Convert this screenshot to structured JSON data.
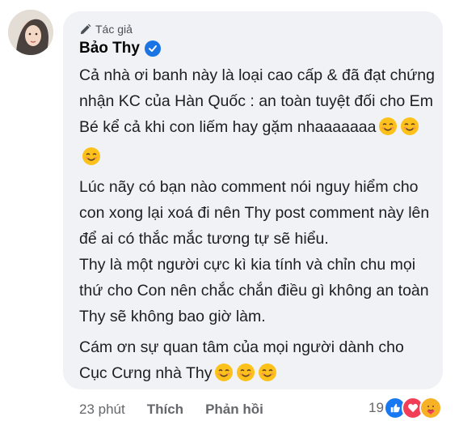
{
  "comment": {
    "author_badge": "Tác giả",
    "author_name": "Bảo Thy",
    "paragraphs": [
      "Cả nhà ơi banh này là loại cao cấp & đã đạt chứng nhận KC của Hàn Quốc : an toàn tuyệt đối cho Em Bé kể cả khi con liếm hay gặm nhaaaaaaa",
      "Lúc nãy có bạn nào comment nói nguy hiểm cho con xong lại xoá đi nên Thy post comment này lên để ai có thắc mắc tương tự sẽ hiểu.",
      "Thy là một người cực kì kia tính và chỉn chu mọi thứ cho Con nên chắc chắn điều gì không an toàn Thy sẽ không bao giờ làm.",
      "Cám ơn sự quan tâm của mọi người dành cho Cục Cưng nhà Thy"
    ]
  },
  "footer": {
    "time": "23 phút",
    "like": "Thích",
    "reply": "Phản hồi",
    "reaction_count": "19"
  },
  "icons": {
    "badge": "pencil-icon",
    "verified": "verified-check-icon",
    "emoji": "smiling-face-emoji",
    "reactions": [
      "like-reaction-icon",
      "love-reaction-icon",
      "care-reaction-icon"
    ]
  },
  "colors": {
    "bubble": "#f0f2f5",
    "verified": "#1b74e4",
    "like": "#1877f2",
    "love": "#f33e58",
    "care": "#f7b125"
  }
}
